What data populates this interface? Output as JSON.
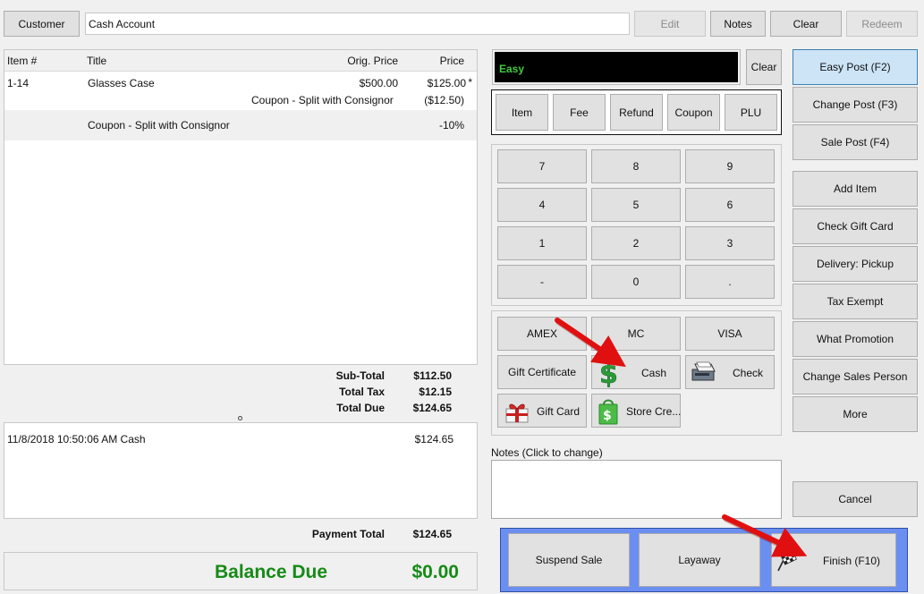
{
  "top_bar": {
    "customer_button": "Customer",
    "customer_value": "Cash Account",
    "edit_button": "Edit",
    "notes_button": "Notes",
    "clear_button": "Clear",
    "redeem_button": "Redeem"
  },
  "items_table": {
    "headers": {
      "item": "Item #",
      "title": "Title",
      "orig_price": "Orig. Price",
      "price": "Price"
    },
    "rows": [
      {
        "item": "1-14",
        "title": "Glasses Case",
        "orig_price": "$500.00",
        "price": "$125.00",
        "flag": "*",
        "sub_label": "Coupon - Split with Consignor",
        "sub_price": "($12.50)"
      },
      {
        "item": "",
        "title": "Coupon - Split with Consignor",
        "orig_price": "",
        "price": "-10%"
      }
    ]
  },
  "totals": {
    "subtotal_label": "Sub-Total",
    "subtotal_value": "$112.50",
    "tax_label": "Total Tax",
    "tax_value": "$12.15",
    "due_label": "Total Due",
    "due_value": "$124.65"
  },
  "payments": {
    "rows": [
      {
        "desc": "11/8/2018 10:50:06 AM Cash",
        "amount": "$124.65"
      }
    ],
    "total_label": "Payment Total",
    "total_value": "$124.65"
  },
  "balance": {
    "label": "Balance Due",
    "value": "$0.00"
  },
  "entry": {
    "display_text": "Easy",
    "clear_button": "Clear",
    "modes": [
      "Item",
      "Fee",
      "Refund",
      "Coupon",
      "PLU"
    ]
  },
  "keypad": [
    "7",
    "8",
    "9",
    "4",
    "5",
    "6",
    "1",
    "2",
    "3",
    "-",
    "0",
    "."
  ],
  "tenders": {
    "amex": "AMEX",
    "mc": "MC",
    "visa": "VISA",
    "gift_certificate": "Gift Certificate",
    "cash": "Cash",
    "check": "Check",
    "gift_card": "Gift Card",
    "store_credit": "Store Cre..."
  },
  "notes": {
    "label": "Notes (Click to change)",
    "value": ""
  },
  "bottom": {
    "suspend": "Suspend Sale",
    "layaway": "Layaway",
    "finish": "Finish (F10)"
  },
  "side_buttons": {
    "easy_post": "Easy Post (F2)",
    "change_post": "Change Post (F3)",
    "sale_post": "Sale Post (F4)",
    "add_item": "Add Item",
    "check_gift_card": "Check Gift Card",
    "delivery": "Delivery: Pickup",
    "tax_exempt": "Tax Exempt",
    "what_promotion": "What Promotion",
    "change_sales_person": "Change Sales Person",
    "more": "More",
    "cancel": "Cancel"
  },
  "colors": {
    "display_bg": "#000000",
    "display_text": "#3dcc3d",
    "balance_green": "#168a16",
    "bottom_panel": "#6b8ff0",
    "primary_button": "#cde4f7",
    "arrow_red": "#e01010"
  }
}
